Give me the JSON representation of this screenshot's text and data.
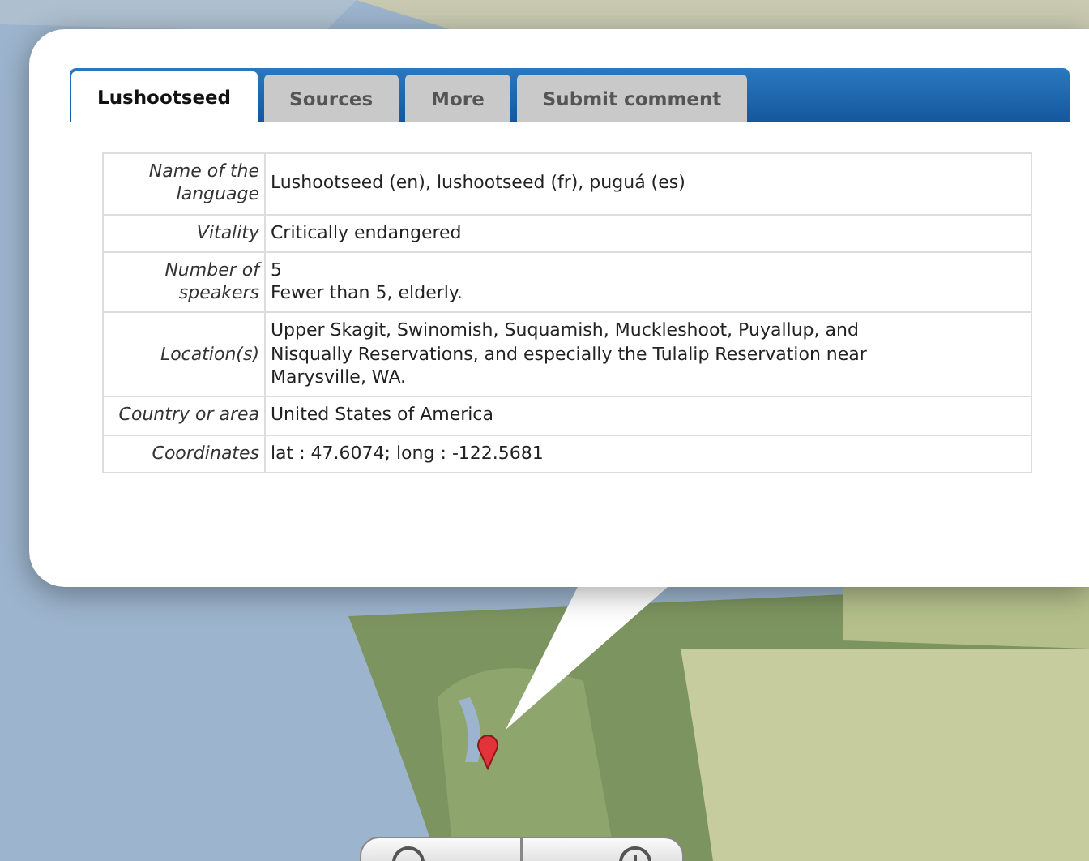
{
  "tabs": [
    {
      "label": "Lushootseed",
      "selected": true
    },
    {
      "label": "Sources",
      "selected": false
    },
    {
      "label": "More",
      "selected": false
    },
    {
      "label": "Submit comment",
      "selected": false
    }
  ],
  "table": {
    "rows": [
      {
        "label": "Name of the language",
        "value": [
          "Lushootseed (en), lushootseed (fr), puguá (es)"
        ]
      },
      {
        "label": "Vitality",
        "value": [
          "Critically endangered"
        ]
      },
      {
        "label": "Number of speakers",
        "value": [
          "5",
          "Fewer than 5, elderly."
        ]
      },
      {
        "label": "Location(s)",
        "value": [
          "Upper Skagit, Swinomish, Suquamish, Muckleshoot, Puyallup, and Nisqually Reservations, and especially the Tulalip Reservation near Marysville, WA."
        ]
      },
      {
        "label": "Country or area",
        "value": [
          "United States of America"
        ]
      },
      {
        "label": "Coordinates",
        "value": [
          "lat : 47.6074; long : -122.5681"
        ]
      }
    ]
  }
}
